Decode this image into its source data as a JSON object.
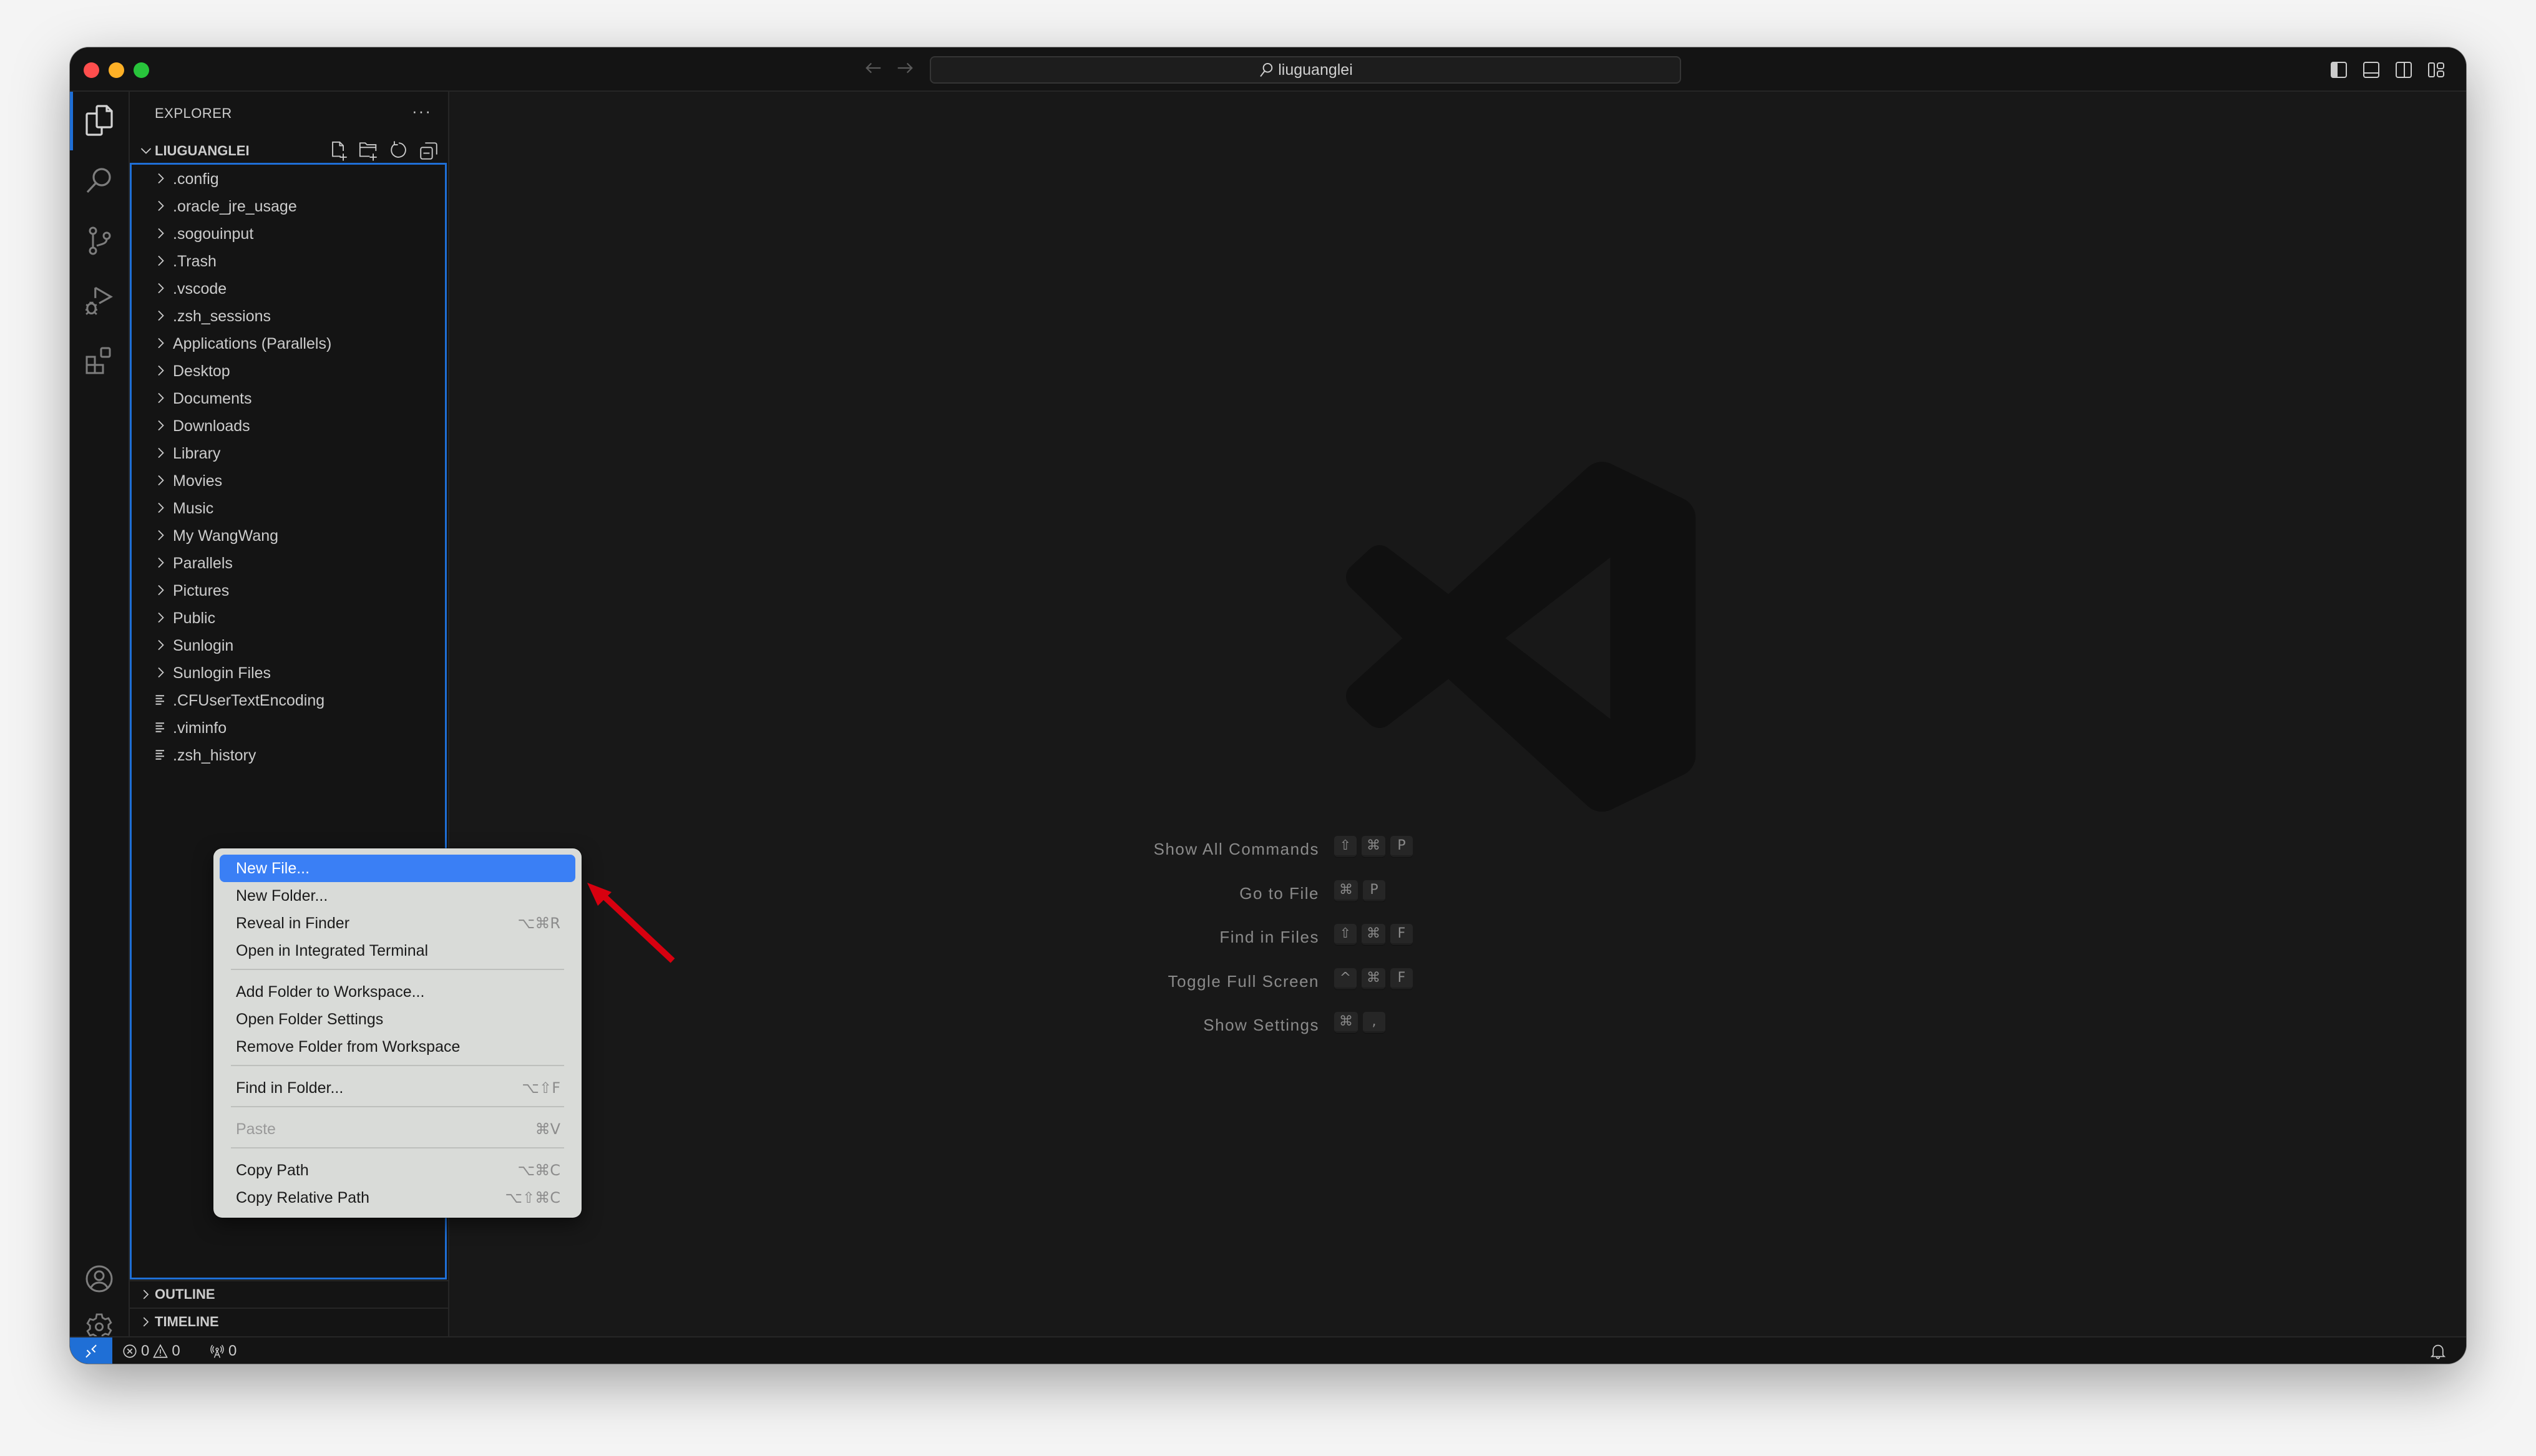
{
  "titlebar": {
    "search_text": "liuguanglei",
    "back_icon": "arrow-left-icon",
    "forward_icon": "arrow-right-icon",
    "layout_icons": [
      "toggle-primary-sidebar-icon",
      "toggle-panel-icon",
      "toggle-secondary-sidebar-icon",
      "customize-layout-icon"
    ]
  },
  "activity_bar": {
    "items": [
      "explorer-icon",
      "search-icon",
      "source-control-icon",
      "run-debug-icon",
      "extensions-icon"
    ],
    "bottom": [
      "accounts-icon",
      "manage-gear-icon"
    ]
  },
  "sidebar": {
    "title": "EXPLORER",
    "more": "···",
    "folder": "LIUGUANGLEI",
    "tree": [
      {
        "name": ".config",
        "type": "folder"
      },
      {
        "name": ".oracle_jre_usage",
        "type": "folder"
      },
      {
        "name": ".sogouinput",
        "type": "folder"
      },
      {
        "name": ".Trash",
        "type": "folder"
      },
      {
        "name": ".vscode",
        "type": "folder"
      },
      {
        "name": ".zsh_sessions",
        "type": "folder"
      },
      {
        "name": "Applications (Parallels)",
        "type": "folder"
      },
      {
        "name": "Desktop",
        "type": "folder"
      },
      {
        "name": "Documents",
        "type": "folder"
      },
      {
        "name": "Downloads",
        "type": "folder"
      },
      {
        "name": "Library",
        "type": "folder"
      },
      {
        "name": "Movies",
        "type": "folder"
      },
      {
        "name": "Music",
        "type": "folder"
      },
      {
        "name": "My WangWang",
        "type": "folder"
      },
      {
        "name": "Parallels",
        "type": "folder"
      },
      {
        "name": "Pictures",
        "type": "folder"
      },
      {
        "name": "Public",
        "type": "folder"
      },
      {
        "name": "Sunlogin",
        "type": "folder"
      },
      {
        "name": "Sunlogin Files",
        "type": "folder"
      },
      {
        "name": ".CFUserTextEncoding",
        "type": "file"
      },
      {
        "name": ".viminfo",
        "type": "file"
      },
      {
        "name": ".zsh_history",
        "type": "file"
      }
    ],
    "panels": [
      "OUTLINE",
      "TIMELINE"
    ]
  },
  "editor": {
    "shortcuts": [
      {
        "label": "Show All Commands",
        "keys": [
          "⇧",
          "⌘",
          "P"
        ]
      },
      {
        "label": "Go to File",
        "keys": [
          "⌘",
          "P"
        ]
      },
      {
        "label": "Find in Files",
        "keys": [
          "⇧",
          "⌘",
          "F"
        ]
      },
      {
        "label": "Toggle Full Screen",
        "keys": [
          "^",
          "⌘",
          "F"
        ]
      },
      {
        "label": "Show Settings",
        "keys": [
          "⌘",
          ","
        ]
      }
    ]
  },
  "context_menu": {
    "items": [
      {
        "label": "New File...",
        "shortcut": "",
        "highlighted": true,
        "disabled": false
      },
      {
        "label": "New Folder...",
        "shortcut": "",
        "highlighted": false,
        "disabled": false
      },
      {
        "label": "Reveal in Finder",
        "shortcut": "⌥⌘R",
        "highlighted": false,
        "disabled": false
      },
      {
        "label": "Open in Integrated Terminal",
        "shortcut": "",
        "highlighted": false,
        "disabled": false
      },
      {
        "separator": true
      },
      {
        "label": "Add Folder to Workspace...",
        "shortcut": "",
        "highlighted": false,
        "disabled": false
      },
      {
        "label": "Open Folder Settings",
        "shortcut": "",
        "highlighted": false,
        "disabled": false
      },
      {
        "label": "Remove Folder from Workspace",
        "shortcut": "",
        "highlighted": false,
        "disabled": false
      },
      {
        "separator": true
      },
      {
        "label": "Find in Folder...",
        "shortcut": "⌥⇧F",
        "highlighted": false,
        "disabled": false
      },
      {
        "separator": true
      },
      {
        "label": "Paste",
        "shortcut": "⌘V",
        "highlighted": false,
        "disabled": true
      },
      {
        "separator": true
      },
      {
        "label": "Copy Path",
        "shortcut": "⌥⌘C",
        "highlighted": false,
        "disabled": false
      },
      {
        "label": "Copy Relative Path",
        "shortcut": "⌥⇧⌘C",
        "highlighted": false,
        "disabled": false
      }
    ]
  },
  "statusbar": {
    "errors": "0",
    "warnings": "0",
    "ports": "0"
  },
  "colors": {
    "accent": "#1f6fd6",
    "menu_highlight": "#3a7ff5",
    "annotation_arrow": "#d7000f"
  }
}
